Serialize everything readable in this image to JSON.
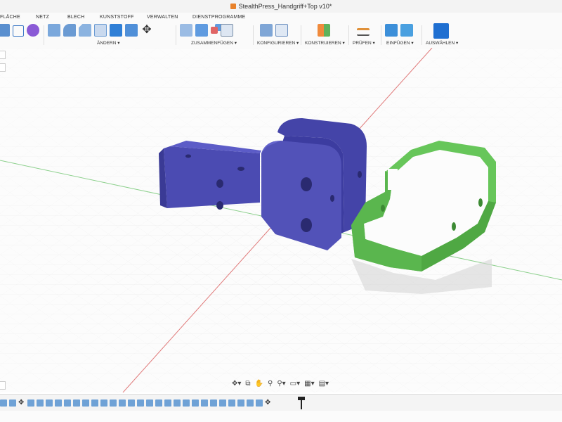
{
  "window": {
    "title": "StealthPress_Handgriff+Top v10*"
  },
  "tabs": [
    "FLÄCHE",
    "NETZ",
    "BLECH",
    "KUNSTSTOFF",
    "VERWALTEN",
    "DIENSTPROGRAMME"
  ],
  "toolbar": {
    "groups": [
      {
        "label": "ÄNDERN ▾"
      },
      {
        "label": "ZUSAMMENFÜGEN ▾"
      },
      {
        "label": "KONFIGURIEREN ▾"
      },
      {
        "label": "KONSTRUIEREN ▾"
      },
      {
        "label": "PRÜFEN ▾"
      },
      {
        "label": "EINFÜGEN ▾"
      },
      {
        "label": "AUSWÄHLEN ▾"
      }
    ]
  },
  "navbar": {
    "icons": [
      "orbit-icon",
      "look-at-icon",
      "pan-icon",
      "zoom-icon",
      "fit-icon",
      "display-settings-icon",
      "grid-settings-icon",
      "viewports-icon"
    ]
  },
  "colors": {
    "body_blue": "#4b4bb2",
    "body_green": "#67c65a",
    "x_axis": "#e06060",
    "y_axis": "#70c070"
  }
}
